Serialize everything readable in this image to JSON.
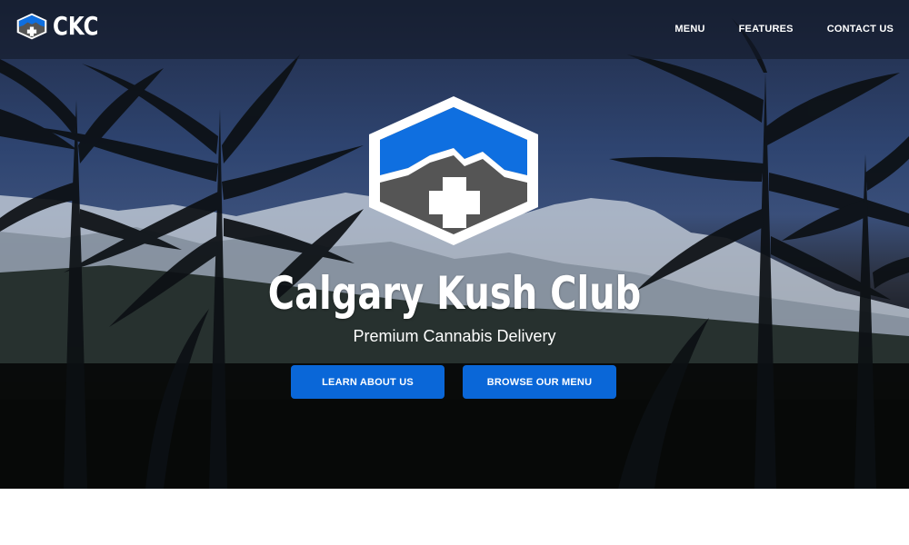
{
  "colors": {
    "accent": "#0a67d8",
    "logo_blue": "#0f6fe0",
    "logo_gray": "#555555",
    "nav_background": "#1b2236",
    "text": "#ffffff"
  },
  "brand": {
    "name": "CKC",
    "logo_icon": "mountain-cross-hexagon-icon"
  },
  "nav": {
    "items": [
      {
        "label": "MENU"
      },
      {
        "label": "FEATURES"
      },
      {
        "label": "CONTACT US"
      }
    ]
  },
  "hero": {
    "logo_icon": "mountain-cross-hexagon-icon",
    "background_icon": "cannabis-plants-mountain-photo",
    "title": "Calgary Kush Club",
    "subtitle": "Premium Cannabis Delivery",
    "buttons": {
      "learn": "LEARN ABOUT US",
      "menu": "BROWSE OUR MENU"
    }
  }
}
